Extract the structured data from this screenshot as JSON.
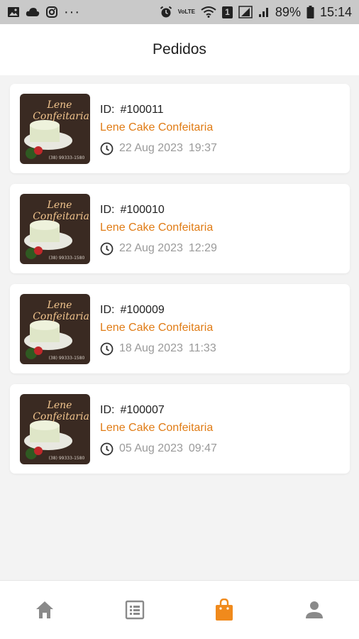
{
  "status_bar": {
    "left_icons": [
      "image-icon",
      "cloud-icon",
      "instagram-icon",
      "more-dots-icon"
    ],
    "right_icons": [
      "alarm-icon",
      "volte-icon",
      "wifi-icon",
      "sim-badge-icon",
      "signal-icon",
      "battery-icon"
    ],
    "more_glyph": "···",
    "volte_text": "VoLTE",
    "sim_badge": "1",
    "battery_percent": "89%",
    "time": "15:14"
  },
  "header": {
    "title": "Pedidos"
  },
  "orders": [
    {
      "id_label": "ID:",
      "id": "#100011",
      "store": "Lene Cake Confeitaria",
      "date": "22 Aug 2023",
      "time": "19:37"
    },
    {
      "id_label": "ID:",
      "id": "#100010",
      "store": "Lene Cake Confeitaria",
      "date": "22 Aug 2023",
      "time": "12:29"
    },
    {
      "id_label": "ID:",
      "id": "#100009",
      "store": "Lene Cake Confeitaria",
      "date": "18 Aug 2023",
      "time": "11:33"
    },
    {
      "id_label": "ID:",
      "id": "#100007",
      "store": "Lene Cake Confeitaria",
      "date": "05 Aug 2023",
      "time": "09:47"
    }
  ],
  "logo": {
    "line1": "Lene",
    "line2": "Confeitaria",
    "phone": "(38) 99333-1580"
  },
  "bottom_nav": [
    {
      "name": "home-icon",
      "active": false
    },
    {
      "name": "list-icon",
      "active": false
    },
    {
      "name": "shopping-bag-icon",
      "active": true
    },
    {
      "name": "person-icon",
      "active": false
    }
  ],
  "colors": {
    "accent": "#f08a1c",
    "store_name": "#e07b14",
    "inactive_nav": "#8a8a8a",
    "logo_bg": "#3a2a22"
  }
}
